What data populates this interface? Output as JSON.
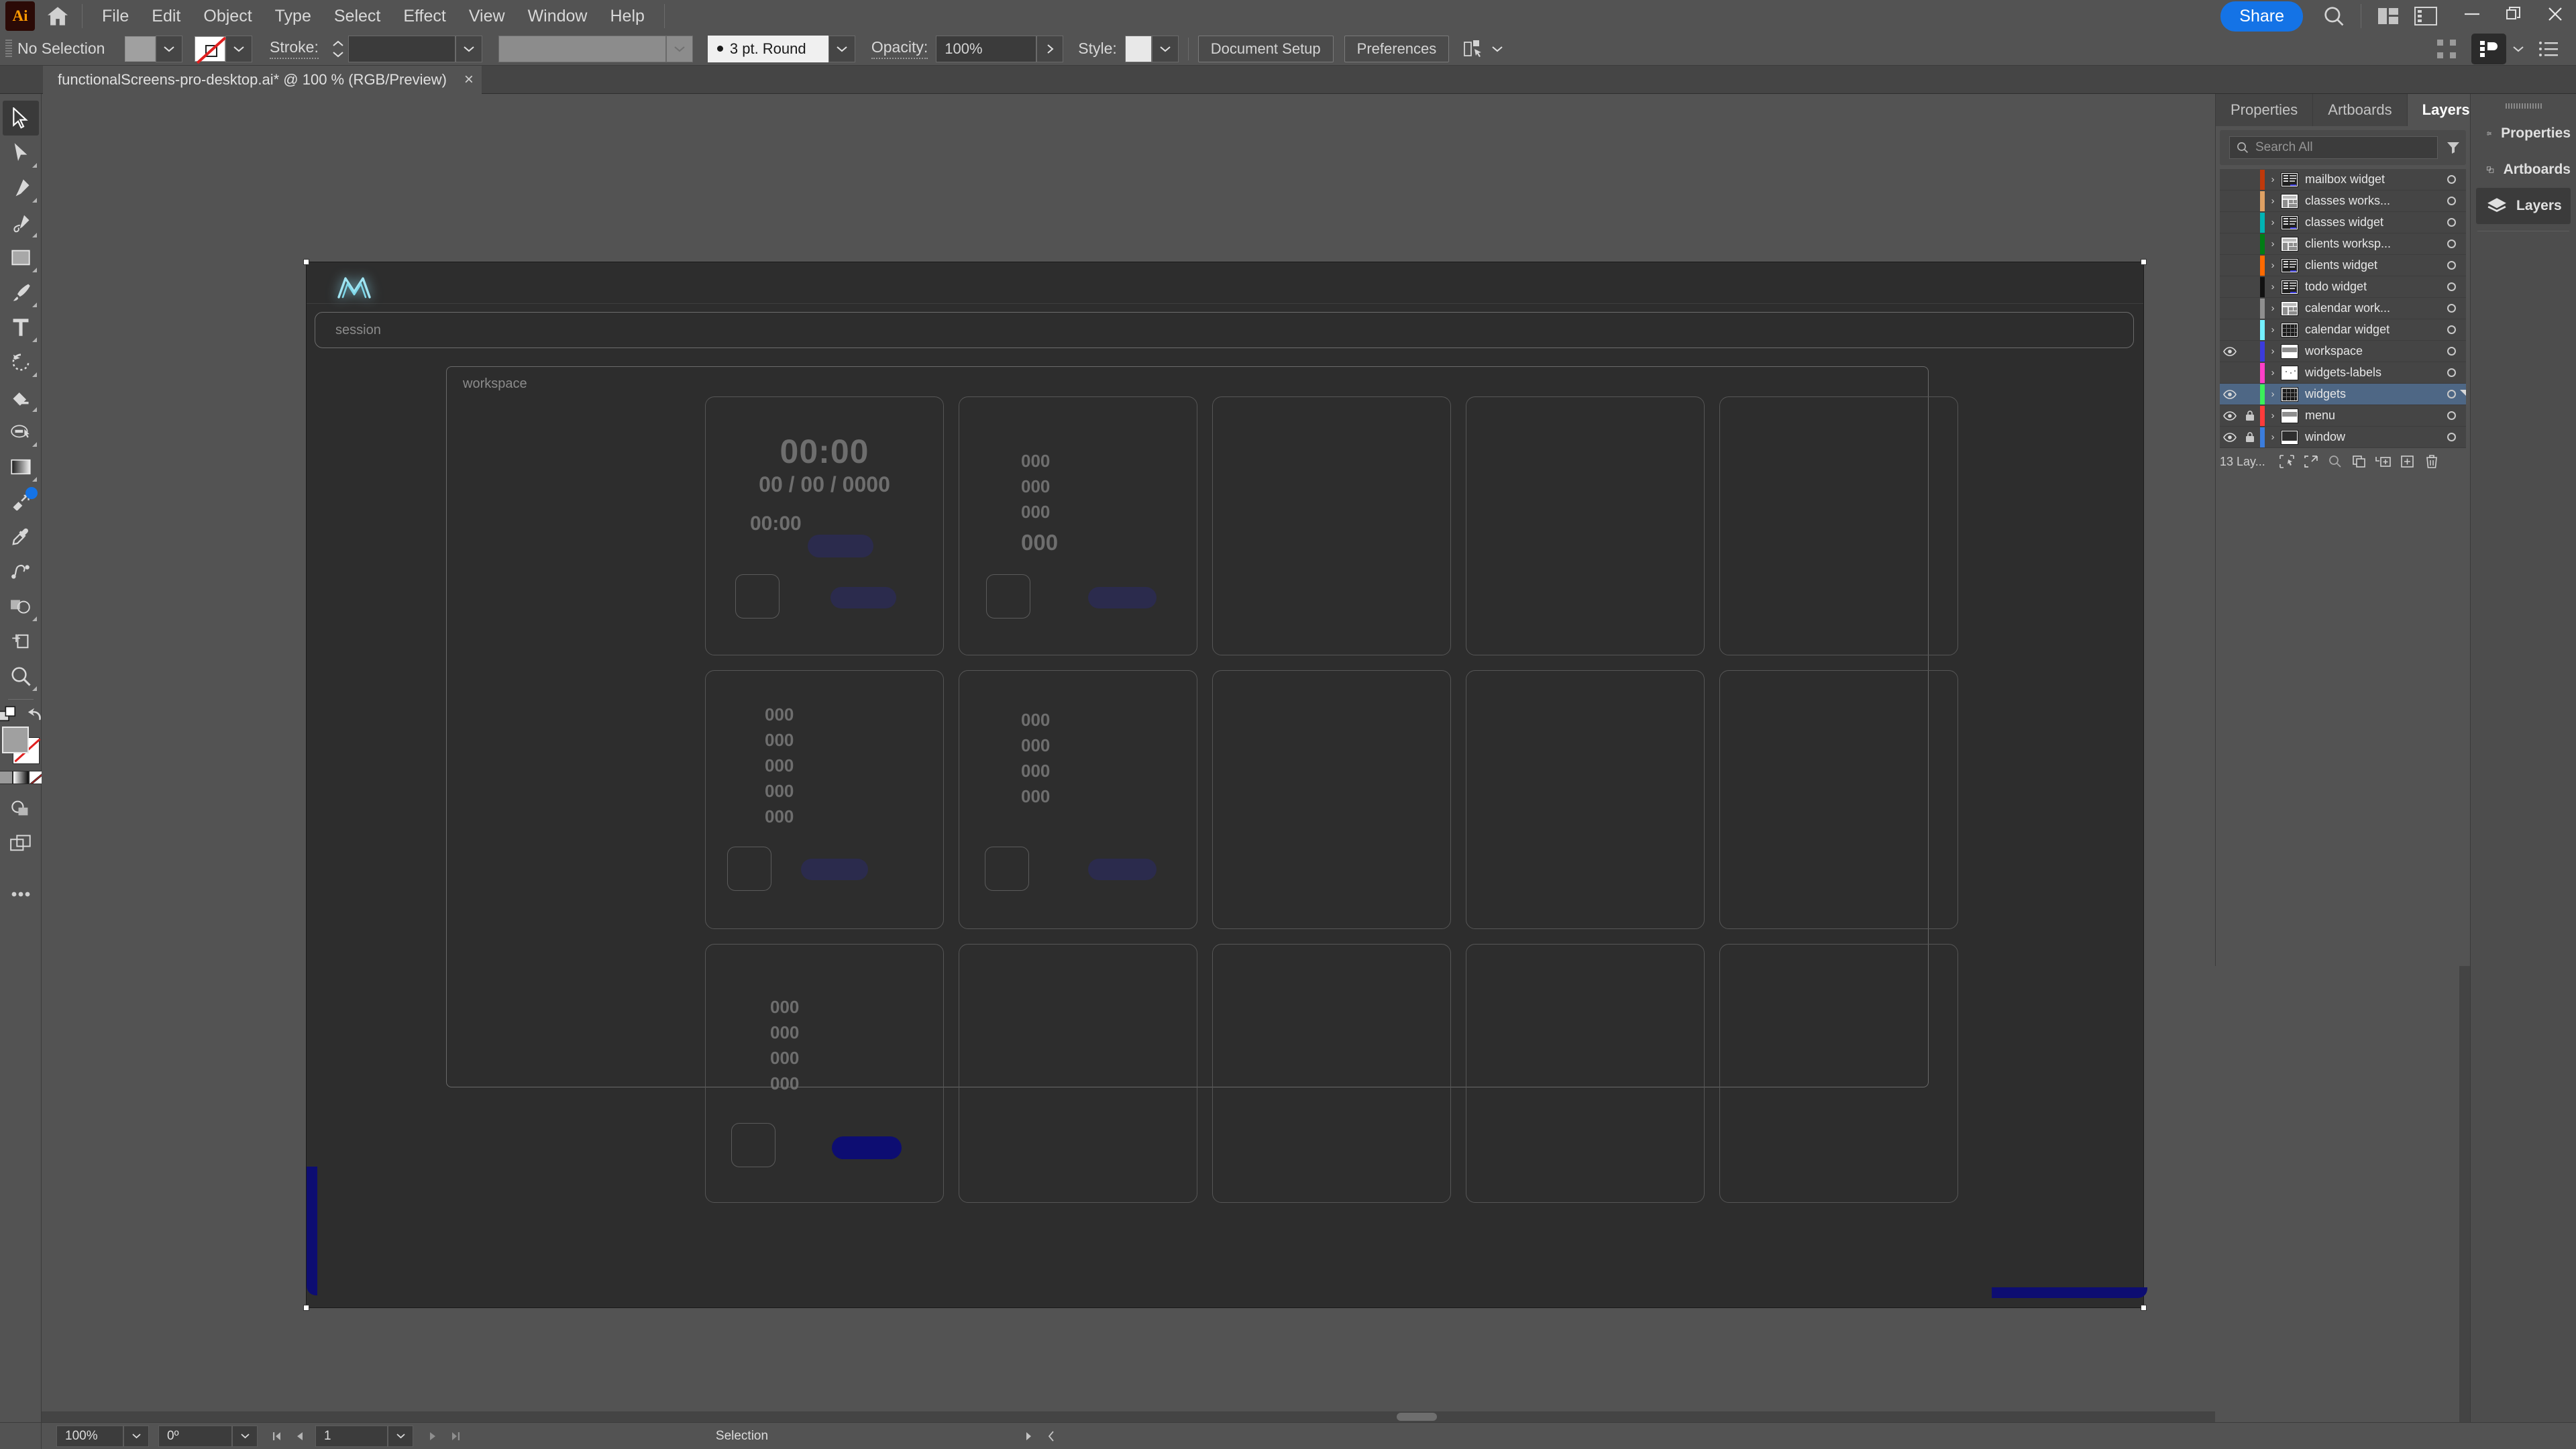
{
  "app": {
    "name": "Adobe Illustrator",
    "logo_text": "Ai"
  },
  "menubar": {
    "items": [
      "File",
      "Edit",
      "Object",
      "Type",
      "Select",
      "Effect",
      "View",
      "Window",
      "Help"
    ],
    "share_label": "Share",
    "icons": [
      "home-icon",
      "search-icon",
      "arrange-documents-icon",
      "workspace-switcher-icon"
    ],
    "window_controls": [
      "minimize-icon",
      "restore-icon",
      "close-icon"
    ]
  },
  "controlbar": {
    "selection_state": "No Selection",
    "fill_swatch": "#a0a0a0",
    "stroke_swatch": "none",
    "stroke_label": "Stroke:",
    "stroke_weight": "",
    "variable_width_profile": "",
    "brush_definition": "3 pt. Round",
    "opacity_label": "Opacity:",
    "opacity_value": "100%",
    "style_label": "Style:",
    "document_setup_label": "Document Setup",
    "preferences_label": "Preferences"
  },
  "tabs": {
    "documents": [
      {
        "title": "functionalScreens-pro-desktop.ai* @ 100 % (RGB/Preview)",
        "close": "×",
        "active": true
      }
    ]
  },
  "toolbar": {
    "tools": [
      {
        "name": "selection-tool",
        "active": true,
        "more": false
      },
      {
        "name": "direct-selection-tool",
        "active": false,
        "more": true
      },
      {
        "name": "pen-tool",
        "active": false,
        "more": true
      },
      {
        "name": "curvature-tool",
        "active": false,
        "more": true
      },
      {
        "name": "rectangle-tool",
        "active": false,
        "more": true
      },
      {
        "name": "paintbrush-tool",
        "active": false,
        "more": true
      },
      {
        "name": "type-tool",
        "active": false,
        "more": true
      },
      {
        "name": "rotate-tool",
        "active": false,
        "more": true
      },
      {
        "name": "eraser-tool",
        "active": false,
        "more": true
      },
      {
        "name": "shaper-tool",
        "active": false,
        "more": true
      },
      {
        "name": "gradient-tool",
        "active": false,
        "more": true
      },
      {
        "name": "free-transform-tool",
        "active": false,
        "more": false,
        "badge": true
      },
      {
        "name": "eyedropper-tool",
        "active": false,
        "more": false
      },
      {
        "name": "blend-tool",
        "active": false,
        "more": false
      },
      {
        "name": "shape-builder-tool",
        "active": false,
        "more": true
      },
      {
        "name": "artboard-tool",
        "active": false,
        "more": false
      },
      {
        "name": "zoom-tool",
        "active": false,
        "more": true
      }
    ],
    "bottom": [
      "swap-fill-stroke-icon",
      "default-fill-stroke-icon",
      "fill-stroke-swatches",
      "color-gradient-none-icons",
      "drawing-mode-icon",
      "screen-mode-icon",
      "edit-toolbar-icon"
    ]
  },
  "artwork": {
    "logo_name": "neon-m-logo",
    "session_label": "session",
    "workspace_label": "workspace",
    "clock": {
      "time": "00:00",
      "date": "00 / 00 / 0000",
      "secondary_time": "00:00"
    },
    "widget_numbers": [
      "000",
      "000",
      "000",
      "000",
      "000"
    ],
    "accent_pill_color": "#2b2b4d",
    "selected_pill_color": "#0d0d72"
  },
  "layers_panel": {
    "tabs": [
      "Properties",
      "Artboards",
      "Layers"
    ],
    "active_tab": "Layers",
    "search_placeholder": "Search All",
    "filter_icon": "filter-icon",
    "collapse_icon": "double-chevron-icon",
    "menu_icon": "panel-menu-icon",
    "rows": [
      {
        "name": "mailbox widget",
        "color": "#c0390b",
        "visible": false,
        "locked": false,
        "selected": false,
        "thumb": "list-dark"
      },
      {
        "name": "classes works...",
        "color": "#dfa164",
        "visible": false,
        "locked": false,
        "selected": false,
        "thumb": "layout-light"
      },
      {
        "name": "classes widget",
        "color": "#00b3b3",
        "visible": false,
        "locked": false,
        "selected": false,
        "thumb": "list-dark"
      },
      {
        "name": "clients worksp...",
        "color": "#007d15",
        "visible": false,
        "locked": false,
        "selected": false,
        "thumb": "layout-light"
      },
      {
        "name": "clients widget",
        "color": "#ff6a00",
        "visible": false,
        "locked": false,
        "selected": false,
        "thumb": "list-dark"
      },
      {
        "name": "todo widget",
        "color": "#111111",
        "visible": false,
        "locked": false,
        "selected": false,
        "thumb": "list-dark"
      },
      {
        "name": "calendar work...",
        "color": "#8f8f8f",
        "visible": false,
        "locked": false,
        "selected": false,
        "thumb": "layout-light"
      },
      {
        "name": "calendar widget",
        "color": "#74f0ff",
        "visible": false,
        "locked": false,
        "selected": false,
        "thumb": "grid-dark"
      },
      {
        "name": "workspace",
        "color": "#3b3bdd",
        "visible": true,
        "locked": false,
        "selected": false,
        "thumb": "bar-light"
      },
      {
        "name": "widgets-labels",
        "color": "#ff3fc8",
        "visible": false,
        "locked": false,
        "selected": false,
        "thumb": "dots-light"
      },
      {
        "name": "widgets",
        "color": "#3bf05a",
        "visible": true,
        "locked": false,
        "selected": true,
        "thumb": "grid-dark"
      },
      {
        "name": "menu",
        "color": "#ff3b3b",
        "visible": true,
        "locked": true,
        "selected": false,
        "thumb": "bar-light"
      },
      {
        "name": "window",
        "color": "#3b7ddd",
        "visible": true,
        "locked": true,
        "selected": false,
        "thumb": "window-dark"
      }
    ],
    "footer_count": "13 Lay...",
    "footer_icons": [
      "locate-object-icon",
      "release-to-layers-icon",
      "find-icon",
      "make-clipping-mask-icon",
      "create-sublayer-icon",
      "new-layer-icon",
      "delete-icon"
    ]
  },
  "dock": {
    "items": [
      {
        "label": "Properties",
        "icon": "sliders-icon",
        "active": false
      },
      {
        "label": "Artboards",
        "icon": "artboards-icon",
        "active": false
      },
      {
        "label": "Layers",
        "icon": "layers-icon",
        "active": true
      }
    ]
  },
  "statusbar": {
    "zoom": "100%",
    "rotation": "0º",
    "artboard_number": "1",
    "status_text": "Selection",
    "nav_icons": [
      "first-artboard-icon",
      "prev-artboard-icon",
      "next-artboard-icon",
      "last-artboard-icon"
    ]
  }
}
